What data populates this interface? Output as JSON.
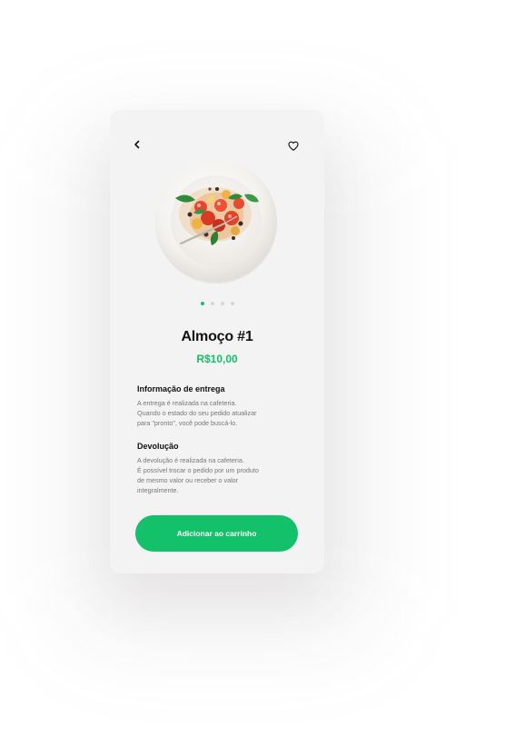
{
  "product": {
    "title": "Almoço #1",
    "price": "R$10,00"
  },
  "header": {
    "back_icon": "chevron-left-icon",
    "favorite_icon": "heart-icon"
  },
  "carousel": {
    "total": 4,
    "active_index": 0
  },
  "delivery_info": {
    "title": "Informação de entrega",
    "lines": [
      "A entrega é realizada na cafeteria.",
      "Quando o estado do seu pedido atualizar",
      "para \"pronto\", você pode buscá-lo."
    ]
  },
  "returns": {
    "title": "Devolução",
    "lines": [
      "A devolução é realizada na cafeteria.",
      "É possível trocar o pedido por um produto",
      "de mesmo valor ou receber o valor",
      "integralmente."
    ]
  },
  "cta": {
    "label": "Adicionar ao carrinho"
  },
  "colors": {
    "accent": "#13c16a",
    "card_bg": "#f3f3f4",
    "text_primary": "#111111",
    "text_secondary": "#777777"
  }
}
